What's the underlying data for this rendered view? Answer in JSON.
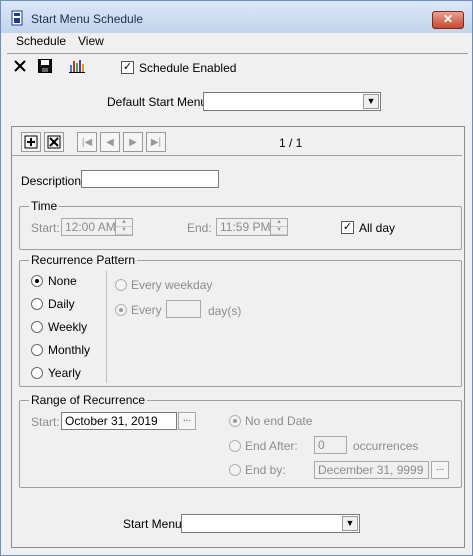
{
  "window": {
    "title": "Start Menu Schedule",
    "close_label": "✕"
  },
  "menu": [
    "Schedule",
    "View"
  ],
  "toolbar": {
    "schedule_enabled_label": "Schedule Enabled",
    "schedule_enabled_checked": "✓"
  },
  "default_start_menu": {
    "label": "Default Start Menu",
    "value": ""
  },
  "navigator": {
    "position": "1 / 1"
  },
  "description": {
    "label": "Description",
    "value": ""
  },
  "time": {
    "group_label": "Time",
    "start_label": "Start:",
    "start_value": "12:00 AM",
    "end_label": "End:",
    "end_value": "11:59 PM",
    "all_day_label": "All day",
    "all_day_checked": "✓"
  },
  "recurrence": {
    "group_label": "Recurrence Pattern",
    "options": [
      "None",
      "Daily",
      "Weekly",
      "Monthly",
      "Yearly"
    ],
    "selected": "None",
    "every_weekday_label": "Every weekday",
    "every_label": "Every",
    "every_value": "",
    "days_label": "day(s)"
  },
  "range": {
    "group_label": "Range of Recurrence",
    "start_label": "Start:",
    "start_value": "October 31, 2019",
    "no_end_label": "No end Date",
    "end_after_label": "End After:",
    "end_after_value": "0",
    "occurrences_label": "occurrences",
    "end_by_label": "End by:",
    "end_by_value": "December 31, 9999",
    "ellipsis": "..."
  },
  "start_menu": {
    "label": "Start Menu",
    "value": ""
  }
}
